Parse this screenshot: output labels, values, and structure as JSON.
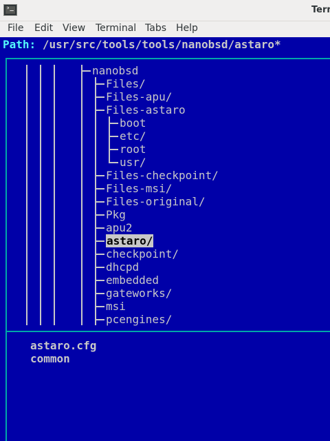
{
  "window": {
    "title": "Term",
    "icon": "terminal-icon"
  },
  "menubar": {
    "items": [
      "File",
      "Edit",
      "View",
      "Terminal",
      "Tabs",
      "Help"
    ]
  },
  "path": {
    "label": "Path:",
    "value": "/usr/src/tools/tools/nanobsd/astaro*"
  },
  "tree": {
    "root": "nanobsd",
    "nodes": [
      {
        "label": "Files/"
      },
      {
        "label": "Files-apu/"
      },
      {
        "label": "Files-astaro"
      },
      {
        "label": "boot"
      },
      {
        "label": "etc/"
      },
      {
        "label": "root"
      },
      {
        "label": "usr/"
      },
      {
        "label": "Files-checkpoint/"
      },
      {
        "label": "Files-msi/"
      },
      {
        "label": "Files-original/"
      },
      {
        "label": "Pkg"
      },
      {
        "label": "apu2"
      },
      {
        "label": "astaro/",
        "selected": true
      },
      {
        "label": "checkpoint/"
      },
      {
        "label": "dhcpd"
      },
      {
        "label": "embedded"
      },
      {
        "label": "gateworks/"
      },
      {
        "label": "msi"
      },
      {
        "label": "pcengines/"
      }
    ]
  },
  "files": [
    "astaro.cfg",
    "common"
  ],
  "colors": {
    "background": "#0000a8",
    "frame": "#00a8a8",
    "text": "#c8c8c8",
    "path_label": "#54fcfc",
    "selection_bg": "#c8c8c8"
  }
}
